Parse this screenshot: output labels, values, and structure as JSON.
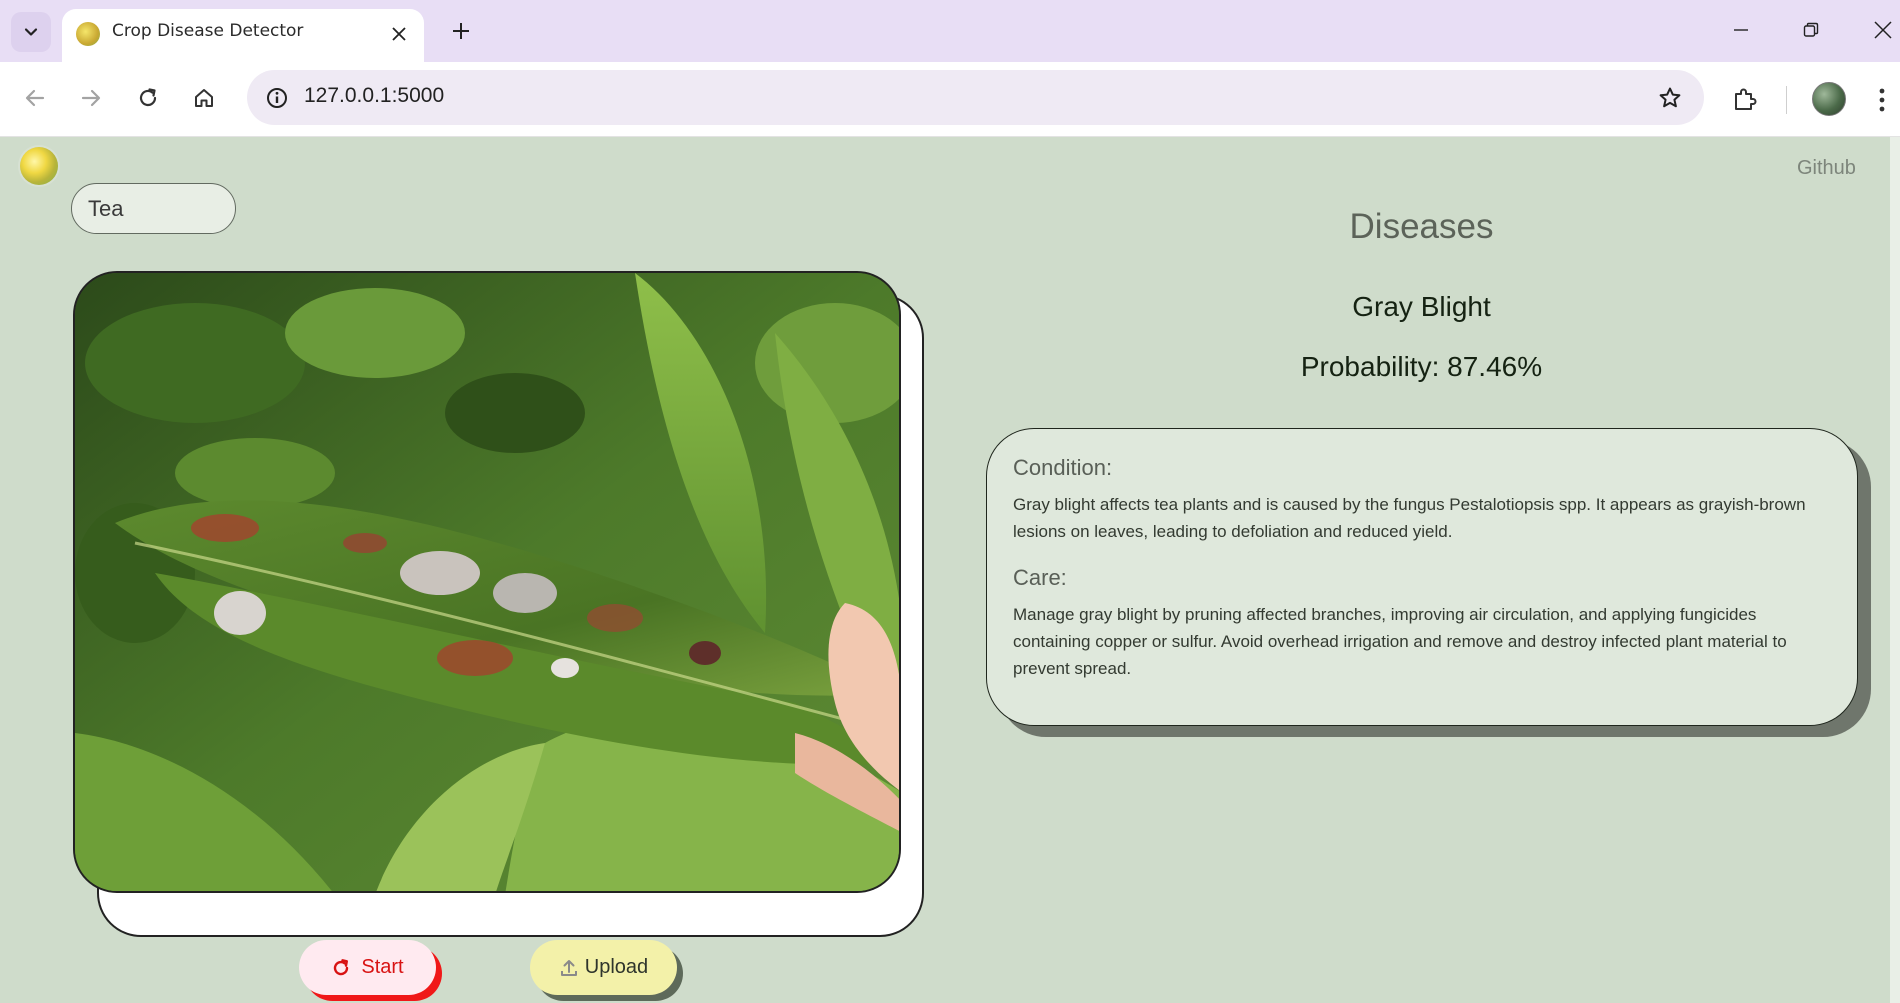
{
  "browser": {
    "tab_title": "Crop Disease Detector",
    "url": "127.0.0.1:5000"
  },
  "header": {
    "github_label": "Github"
  },
  "crop_selector": {
    "value": "Tea"
  },
  "actions": {
    "start_label": "Start",
    "upload_label": "Upload"
  },
  "results": {
    "section_title": "Diseases",
    "disease_name": "Gray Blight",
    "probability_text": "Probability: 87.46%",
    "condition_heading": "Condition:",
    "condition_text": "Gray blight affects tea plants and is caused by the fungus Pestalotiopsis spp. It appears as grayish-brown lesions on leaves, leading to defoliation and reduced yield.",
    "care_heading": "Care:",
    "care_text": "Manage gray blight by pruning affected branches, improving air circulation, and applying fungicides containing copper or sulfur. Avoid overhead irrigation and remove and destroy infected plant material to prevent spread."
  },
  "colors": {
    "page_background": "#cfdccb",
    "start_accent": "#f01818",
    "upload_background": "#f3f1a9",
    "tabstrip_background": "#e8def5"
  }
}
